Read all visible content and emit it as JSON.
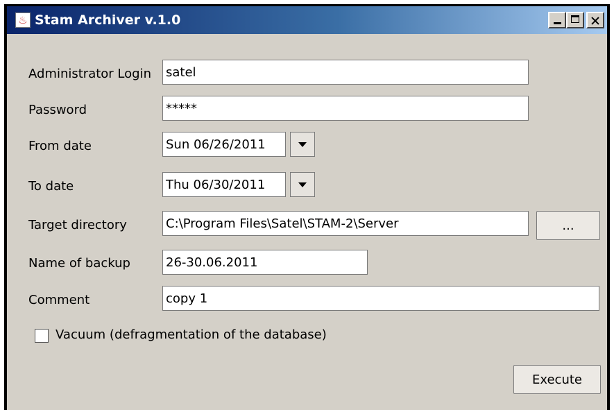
{
  "window": {
    "title": "Stam Archiver v.1.0",
    "icon": "java-app-icon",
    "controls": {
      "minimize": "minimize-icon",
      "maximize": "maximize-icon",
      "close": "close-icon"
    }
  },
  "form": {
    "login_label": "Administrator Login",
    "login_value": "satel",
    "password_label": "Password",
    "password_value": "*****",
    "from_label": "From date",
    "from_value": "Sun 06/26/2011",
    "to_label": "To date",
    "to_value": "Thu 06/30/2011",
    "target_label": "Target directory",
    "target_value": "C:\\Program Files\\Satel\\STAM-2\\Server",
    "browse_label": "...",
    "backup_name_label": "Name of backup",
    "backup_name_value": "26-30.06.2011",
    "comment_label": "Comment",
    "comment_value": "copy 1",
    "vacuum_label": "Vacuum (defragmentation of the database)",
    "vacuum_checked": false,
    "execute_label": "Execute"
  }
}
